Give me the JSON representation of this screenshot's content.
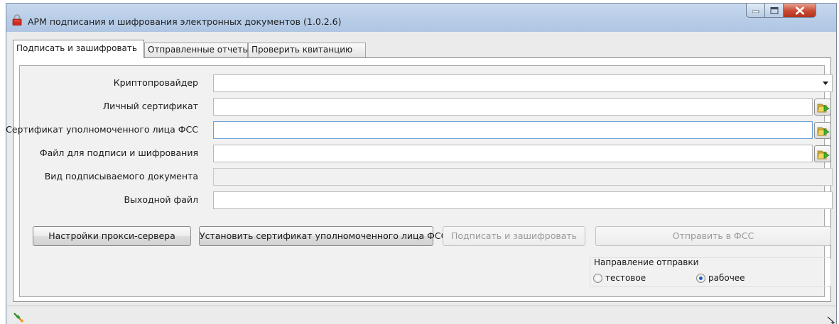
{
  "window": {
    "title": "АРМ подписания и шифрования электронных документов (1.0.2.6)",
    "icon": "lock-icon"
  },
  "tabs": [
    {
      "label": "Подписать и зашифровать",
      "active": true
    },
    {
      "label": "Отправленные отчеты",
      "active": false
    },
    {
      "label": "Проверить квитанцию",
      "active": false
    }
  ],
  "form": {
    "crypto_provider": {
      "label": "Криптопровайдер",
      "value": ""
    },
    "personal_certificate": {
      "label": "Личный сертификат",
      "value": ""
    },
    "fss_certificate": {
      "label": "Сертификат уполномоченного лица ФСС",
      "value": ""
    },
    "input_file": {
      "label": "Файл для подписи и шифрования",
      "value": ""
    },
    "document_type": {
      "label": "Вид подписываемого документа",
      "value": ""
    },
    "output_file": {
      "label": "Выходной файл",
      "value": ""
    }
  },
  "buttons": {
    "proxy_settings": "Настройки прокси-сервера",
    "install_certificate": "Установить сертификат уполномоченного лица ФСС",
    "sign_encrypt": "Подписать и зашифровать",
    "send_fss": "Отправить в ФСС"
  },
  "send_direction": {
    "title": "Направление отправки",
    "options": [
      {
        "label": "тестовое",
        "checked": false
      },
      {
        "label": "рабочее",
        "checked": true
      }
    ]
  },
  "colors": {
    "highlight": "#e0141e",
    "titlebar": "#b8cde7",
    "close_button": "#c94a32"
  }
}
